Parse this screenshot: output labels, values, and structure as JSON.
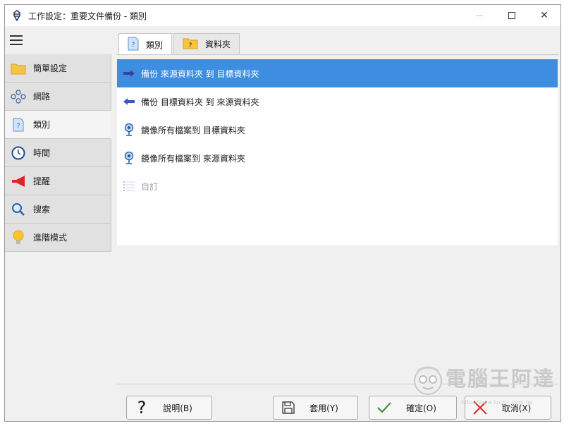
{
  "window": {
    "title": "工作設定：重要文件備份 - 類別",
    "minimize_icon": "minimize-icon",
    "maximize_icon": "maximize-icon",
    "close_glyph": "✕"
  },
  "sidebar": {
    "items": [
      {
        "label": "簡單設定",
        "icon": "folder-icon"
      },
      {
        "label": "網路",
        "icon": "network-icon"
      },
      {
        "label": "類別",
        "icon": "category-icon"
      },
      {
        "label": "時間",
        "icon": "clock-icon"
      },
      {
        "label": "提醒",
        "icon": "megaphone-icon"
      },
      {
        "label": "搜索",
        "icon": "magnifier-icon"
      },
      {
        "label": "進階模式",
        "icon": "lightbulb-icon"
      }
    ],
    "active_index": 2
  },
  "tabs": [
    {
      "label": "類別",
      "icon": "question-doc-icon"
    },
    {
      "label": "資料夾",
      "icon": "question-folder-icon"
    }
  ],
  "category_list": [
    {
      "label": "備份 來源資料夾 到 目標資料夾",
      "icon": "arrow-right-icon",
      "selected": true
    },
    {
      "label": "備份 目標資料夾 到 來源資料夾",
      "icon": "arrow-left-icon",
      "selected": false
    },
    {
      "label": "鏡像所有檔案到 目標資料夾",
      "icon": "mirror-icon",
      "selected": false
    },
    {
      "label": "鏡像所有檔案到 來源資料夾",
      "icon": "mirror-icon",
      "selected": false
    },
    {
      "label": "自訂",
      "icon": "custom-list-icon",
      "disabled": true
    }
  ],
  "buttons": {
    "help": "說明(B)",
    "apply": "套用(Y)",
    "ok": "確定(O)",
    "cancel": "取消(X)"
  },
  "watermark": {
    "text": "電腦王阿達",
    "url": "http://www.kocpc.com.tw"
  },
  "colors": {
    "selection": "#3d8ee0",
    "arrow_blue": "#3b5bbd",
    "ok_green": "#2e8b2e",
    "cancel_red": "#d93030"
  }
}
